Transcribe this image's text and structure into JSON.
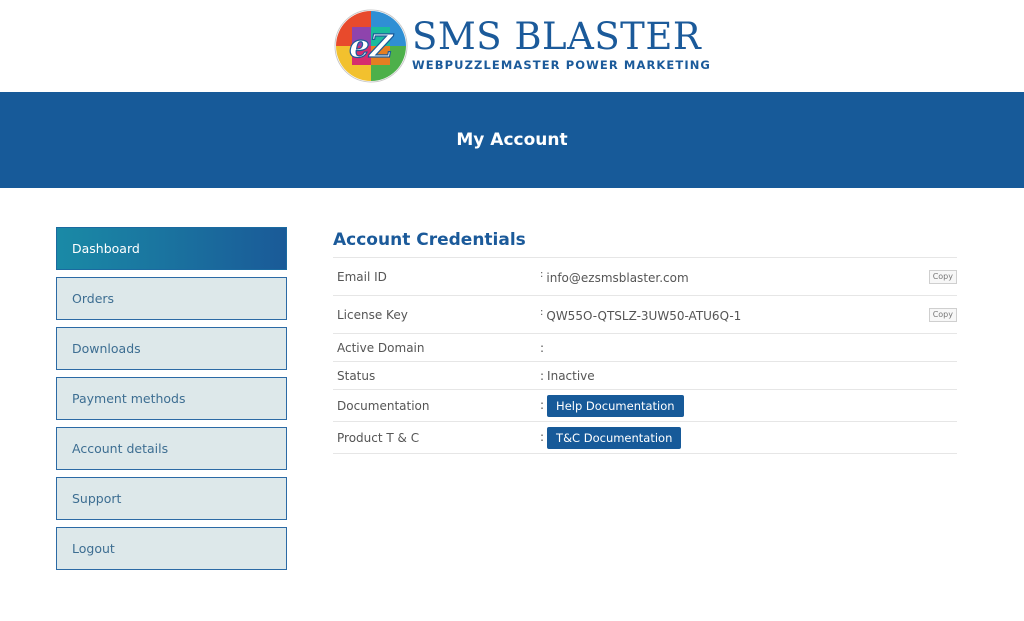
{
  "brand": {
    "title": "SMS BLASTER",
    "subtitle": "WEBPUZZLEMASTER POWER MARKETING",
    "emblem_text": "eZ"
  },
  "banner": {
    "title": "My Account"
  },
  "sidebar": {
    "items": [
      {
        "label": "Dashboard",
        "active": true
      },
      {
        "label": "Orders"
      },
      {
        "label": "Downloads"
      },
      {
        "label": "Payment methods"
      },
      {
        "label": "Account details"
      },
      {
        "label": "Support"
      },
      {
        "label": "Logout"
      }
    ]
  },
  "credentials": {
    "title": "Account Credentials",
    "separator": ":",
    "copy_label": "Copy",
    "rows": [
      {
        "label": "Email ID",
        "value": "info@ezsmsblaster.com"
      },
      {
        "label": "License Key",
        "value": "QW55O-QTSLZ-3UW50-ATU6Q-1"
      },
      {
        "label": "Active Domain",
        "value": ""
      },
      {
        "label": "Status",
        "value": "Inactive"
      },
      {
        "label": "Documentation",
        "button": "Help Documentation"
      },
      {
        "label": "Product T & C",
        "button": "T&C Documentation"
      }
    ]
  },
  "colors": {
    "primary": "#175a99",
    "sidebar_bg": "#dde8ea",
    "active_gradient_start": "#1a8aa6"
  }
}
